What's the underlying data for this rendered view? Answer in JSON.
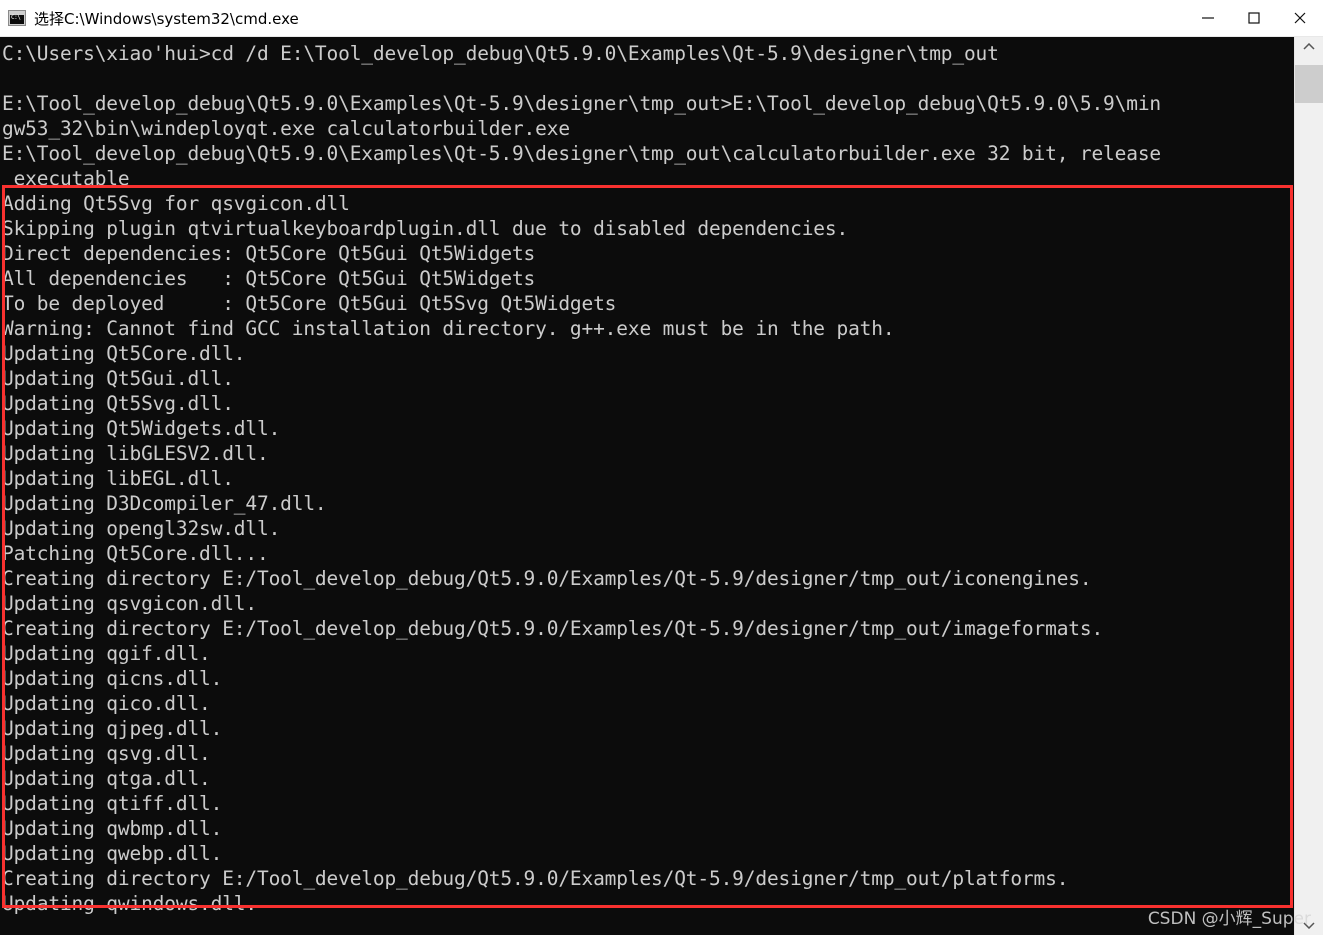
{
  "window": {
    "title": "选择C:\\Windows\\system32\\cmd.exe",
    "icon": "cmd-console-icon",
    "controls": {
      "minimize": "minimize-icon",
      "maximize": "maximize-icon",
      "close": "close-icon"
    }
  },
  "console": {
    "background_color": "#0c0c0c",
    "text_color": "#cccccc",
    "lines": [
      "C:\\Users\\xiao'hui>cd /d E:\\Tool_develop_debug\\Qt5.9.0\\Examples\\Qt-5.9\\designer\\tmp_out",
      "",
      "E:\\Tool_develop_debug\\Qt5.9.0\\Examples\\Qt-5.9\\designer\\tmp_out>E:\\Tool_develop_debug\\Qt5.9.0\\5.9\\min",
      "gw53_32\\bin\\windeployqt.exe calculatorbuilder.exe",
      "E:\\Tool_develop_debug\\Qt5.9.0\\Examples\\Qt-5.9\\designer\\tmp_out\\calculatorbuilder.exe 32 bit, release",
      " executable",
      "Adding Qt5Svg for qsvgicon.dll",
      "Skipping plugin qtvirtualkeyboardplugin.dll due to disabled dependencies.",
      "Direct dependencies: Qt5Core Qt5Gui Qt5Widgets",
      "All dependencies   : Qt5Core Qt5Gui Qt5Widgets",
      "To be deployed     : Qt5Core Qt5Gui Qt5Svg Qt5Widgets",
      "Warning: Cannot find GCC installation directory. g++.exe must be in the path.",
      "Updating Qt5Core.dll.",
      "Updating Qt5Gui.dll.",
      "Updating Qt5Svg.dll.",
      "Updating Qt5Widgets.dll.",
      "Updating libGLESV2.dll.",
      "Updating libEGL.dll.",
      "Updating D3Dcompiler_47.dll.",
      "Updating opengl32sw.dll.",
      "Patching Qt5Core.dll...",
      "Creating directory E:/Tool_develop_debug/Qt5.9.0/Examples/Qt-5.9/designer/tmp_out/iconengines.",
      "Updating qsvgicon.dll.",
      "Creating directory E:/Tool_develop_debug/Qt5.9.0/Examples/Qt-5.9/designer/tmp_out/imageformats.",
      "Updating qgif.dll.",
      "Updating qicns.dll.",
      "Updating qico.dll.",
      "Updating qjpeg.dll.",
      "Updating qsvg.dll.",
      "Updating qtga.dll.",
      "Updating qtiff.dll.",
      "Updating qwbmp.dll.",
      "Updating qwebp.dll.",
      "Creating directory E:/Tool_develop_debug/Qt5.9.0/Examples/Qt-5.9/designer/tmp_out/platforms.",
      "Updating qwindows.dll."
    ]
  },
  "annotation": {
    "color": "#f8312f",
    "shape": "rectangle-highlight"
  },
  "watermark": {
    "text": "CSDN @小辉_Super"
  },
  "scrollbar": {
    "up_arrow": "chevron-up-icon",
    "down_arrow": "chevron-down-icon",
    "thumb": "scrollbar-thumb"
  }
}
